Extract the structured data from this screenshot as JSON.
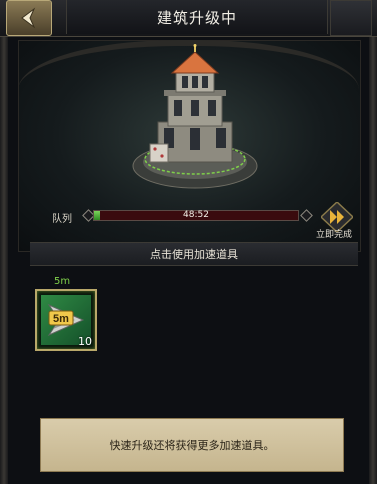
{
  "header": {
    "title": "建筑升级中",
    "back_icon": "back-arrow-icon"
  },
  "queue": {
    "label": "队列",
    "timer": "48:52",
    "progress": 0.03,
    "instant_label": "立即完成"
  },
  "hint": {
    "text": "点击使用加速道具"
  },
  "items": [
    {
      "duration": "5m",
      "badge": "5m",
      "count": "10"
    }
  ],
  "footer": {
    "text": "快速升级还将获得更多加速道具。"
  },
  "colors": {
    "accent_gold": "#b9a86a",
    "progress_green": "#4fb53a",
    "progress_track": "#3a0b0e",
    "item_time": "#7fd14a"
  }
}
